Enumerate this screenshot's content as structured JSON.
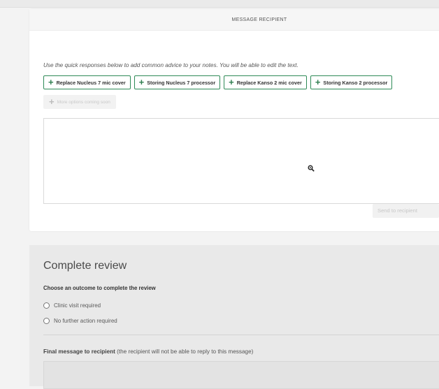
{
  "message_panel": {
    "header": "MESSAGE RECIPIENT",
    "instructions": "Use the quick responses below to add common advice to your notes. You will be able to edit the text.",
    "quick_responses": [
      {
        "label": "Replace Nucleus 7 mic cover"
      },
      {
        "label": "Storing Nucleus 7 processor"
      },
      {
        "label": "Replace Kanso 2 mic cover"
      },
      {
        "label": "Storing Kanso 2 processor"
      }
    ],
    "more_options_label": "More options coming soon",
    "notes_value": "",
    "send_button": "Send to recipient"
  },
  "review": {
    "title": "Complete review",
    "outcome_label": "Choose an outcome to complete the review",
    "options": [
      {
        "label": "Clinic visit required",
        "selected": false
      },
      {
        "label": "No further action required",
        "selected": false
      }
    ],
    "final_message_label": "Final message to recipient",
    "final_message_note": " (the recipient will not be able to reply to this message)",
    "final_message_value": ""
  },
  "colors": {
    "accent_green": "#2e8b57",
    "background": "#f3f3f3",
    "card": "#ffffff",
    "review_panel": "#e9e9e9"
  },
  "icons": [
    "plus-icon",
    "zoom-cursor-icon",
    "radio-unchecked-icon"
  ]
}
